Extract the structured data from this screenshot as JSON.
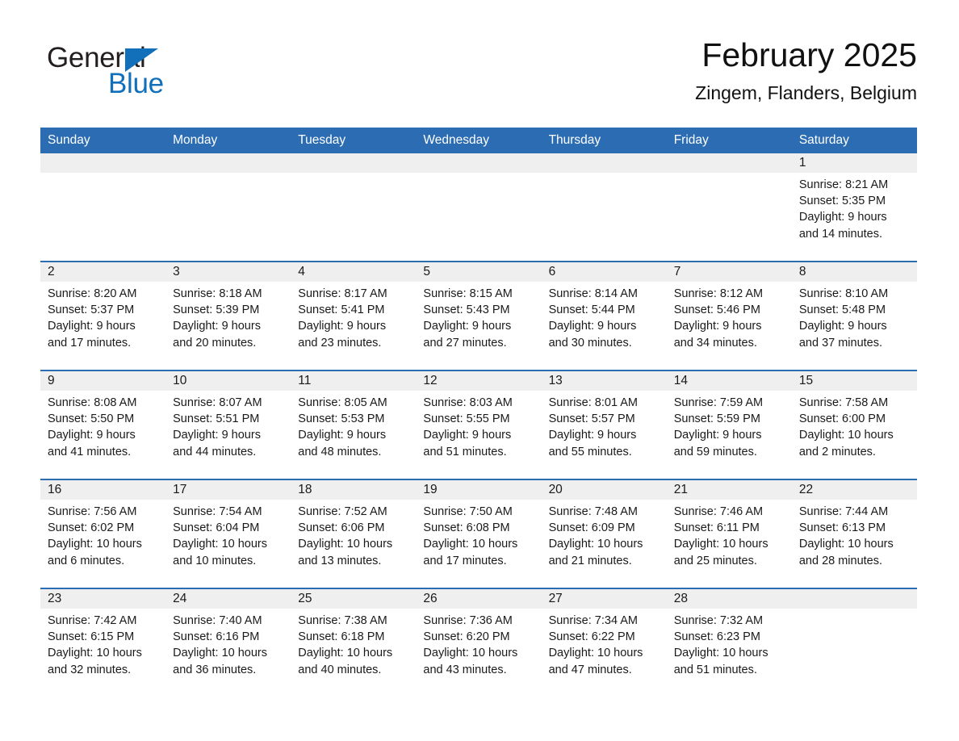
{
  "brand": {
    "name_part1": "General",
    "name_part2": "Blue",
    "triangle_color": "#1270ba",
    "text_color": "#231f20"
  },
  "header": {
    "title": "February 2025",
    "subtitle": "Zingem, Flanders, Belgium"
  },
  "theme": {
    "header_bg": "#2b6cb3",
    "header_text": "#ffffff",
    "daynum_band_bg": "#efefef",
    "row_separator": "#2b6cb3",
    "cell_bg": "#ffffff",
    "body_text": "#1a1a1a"
  },
  "weekdays": [
    "Sunday",
    "Monday",
    "Tuesday",
    "Wednesday",
    "Thursday",
    "Friday",
    "Saturday"
  ],
  "weeks": [
    [
      {
        "day": "",
        "lines": []
      },
      {
        "day": "",
        "lines": []
      },
      {
        "day": "",
        "lines": []
      },
      {
        "day": "",
        "lines": []
      },
      {
        "day": "",
        "lines": []
      },
      {
        "day": "",
        "lines": []
      },
      {
        "day": "1",
        "lines": [
          "Sunrise: 8:21 AM",
          "Sunset: 5:35 PM",
          "Daylight: 9 hours",
          "and 14 minutes."
        ]
      }
    ],
    [
      {
        "day": "2",
        "lines": [
          "Sunrise: 8:20 AM",
          "Sunset: 5:37 PM",
          "Daylight: 9 hours",
          "and 17 minutes."
        ]
      },
      {
        "day": "3",
        "lines": [
          "Sunrise: 8:18 AM",
          "Sunset: 5:39 PM",
          "Daylight: 9 hours",
          "and 20 minutes."
        ]
      },
      {
        "day": "4",
        "lines": [
          "Sunrise: 8:17 AM",
          "Sunset: 5:41 PM",
          "Daylight: 9 hours",
          "and 23 minutes."
        ]
      },
      {
        "day": "5",
        "lines": [
          "Sunrise: 8:15 AM",
          "Sunset: 5:43 PM",
          "Daylight: 9 hours",
          "and 27 minutes."
        ]
      },
      {
        "day": "6",
        "lines": [
          "Sunrise: 8:14 AM",
          "Sunset: 5:44 PM",
          "Daylight: 9 hours",
          "and 30 minutes."
        ]
      },
      {
        "day": "7",
        "lines": [
          "Sunrise: 8:12 AM",
          "Sunset: 5:46 PM",
          "Daylight: 9 hours",
          "and 34 minutes."
        ]
      },
      {
        "day": "8",
        "lines": [
          "Sunrise: 8:10 AM",
          "Sunset: 5:48 PM",
          "Daylight: 9 hours",
          "and 37 minutes."
        ]
      }
    ],
    [
      {
        "day": "9",
        "lines": [
          "Sunrise: 8:08 AM",
          "Sunset: 5:50 PM",
          "Daylight: 9 hours",
          "and 41 minutes."
        ]
      },
      {
        "day": "10",
        "lines": [
          "Sunrise: 8:07 AM",
          "Sunset: 5:51 PM",
          "Daylight: 9 hours",
          "and 44 minutes."
        ]
      },
      {
        "day": "11",
        "lines": [
          "Sunrise: 8:05 AM",
          "Sunset: 5:53 PM",
          "Daylight: 9 hours",
          "and 48 minutes."
        ]
      },
      {
        "day": "12",
        "lines": [
          "Sunrise: 8:03 AM",
          "Sunset: 5:55 PM",
          "Daylight: 9 hours",
          "and 51 minutes."
        ]
      },
      {
        "day": "13",
        "lines": [
          "Sunrise: 8:01 AM",
          "Sunset: 5:57 PM",
          "Daylight: 9 hours",
          "and 55 minutes."
        ]
      },
      {
        "day": "14",
        "lines": [
          "Sunrise: 7:59 AM",
          "Sunset: 5:59 PM",
          "Daylight: 9 hours",
          "and 59 minutes."
        ]
      },
      {
        "day": "15",
        "lines": [
          "Sunrise: 7:58 AM",
          "Sunset: 6:00 PM",
          "Daylight: 10 hours",
          "and 2 minutes."
        ]
      }
    ],
    [
      {
        "day": "16",
        "lines": [
          "Sunrise: 7:56 AM",
          "Sunset: 6:02 PM",
          "Daylight: 10 hours",
          "and 6 minutes."
        ]
      },
      {
        "day": "17",
        "lines": [
          "Sunrise: 7:54 AM",
          "Sunset: 6:04 PM",
          "Daylight: 10 hours",
          "and 10 minutes."
        ]
      },
      {
        "day": "18",
        "lines": [
          "Sunrise: 7:52 AM",
          "Sunset: 6:06 PM",
          "Daylight: 10 hours",
          "and 13 minutes."
        ]
      },
      {
        "day": "19",
        "lines": [
          "Sunrise: 7:50 AM",
          "Sunset: 6:08 PM",
          "Daylight: 10 hours",
          "and 17 minutes."
        ]
      },
      {
        "day": "20",
        "lines": [
          "Sunrise: 7:48 AM",
          "Sunset: 6:09 PM",
          "Daylight: 10 hours",
          "and 21 minutes."
        ]
      },
      {
        "day": "21",
        "lines": [
          "Sunrise: 7:46 AM",
          "Sunset: 6:11 PM",
          "Daylight: 10 hours",
          "and 25 minutes."
        ]
      },
      {
        "day": "22",
        "lines": [
          "Sunrise: 7:44 AM",
          "Sunset: 6:13 PM",
          "Daylight: 10 hours",
          "and 28 minutes."
        ]
      }
    ],
    [
      {
        "day": "23",
        "lines": [
          "Sunrise: 7:42 AM",
          "Sunset: 6:15 PM",
          "Daylight: 10 hours",
          "and 32 minutes."
        ]
      },
      {
        "day": "24",
        "lines": [
          "Sunrise: 7:40 AM",
          "Sunset: 6:16 PM",
          "Daylight: 10 hours",
          "and 36 minutes."
        ]
      },
      {
        "day": "25",
        "lines": [
          "Sunrise: 7:38 AM",
          "Sunset: 6:18 PM",
          "Daylight: 10 hours",
          "and 40 minutes."
        ]
      },
      {
        "day": "26",
        "lines": [
          "Sunrise: 7:36 AM",
          "Sunset: 6:20 PM",
          "Daylight: 10 hours",
          "and 43 minutes."
        ]
      },
      {
        "day": "27",
        "lines": [
          "Sunrise: 7:34 AM",
          "Sunset: 6:22 PM",
          "Daylight: 10 hours",
          "and 47 minutes."
        ]
      },
      {
        "day": "28",
        "lines": [
          "Sunrise: 7:32 AM",
          "Sunset: 6:23 PM",
          "Daylight: 10 hours",
          "and 51 minutes."
        ]
      },
      {
        "day": "",
        "lines": []
      }
    ]
  ]
}
